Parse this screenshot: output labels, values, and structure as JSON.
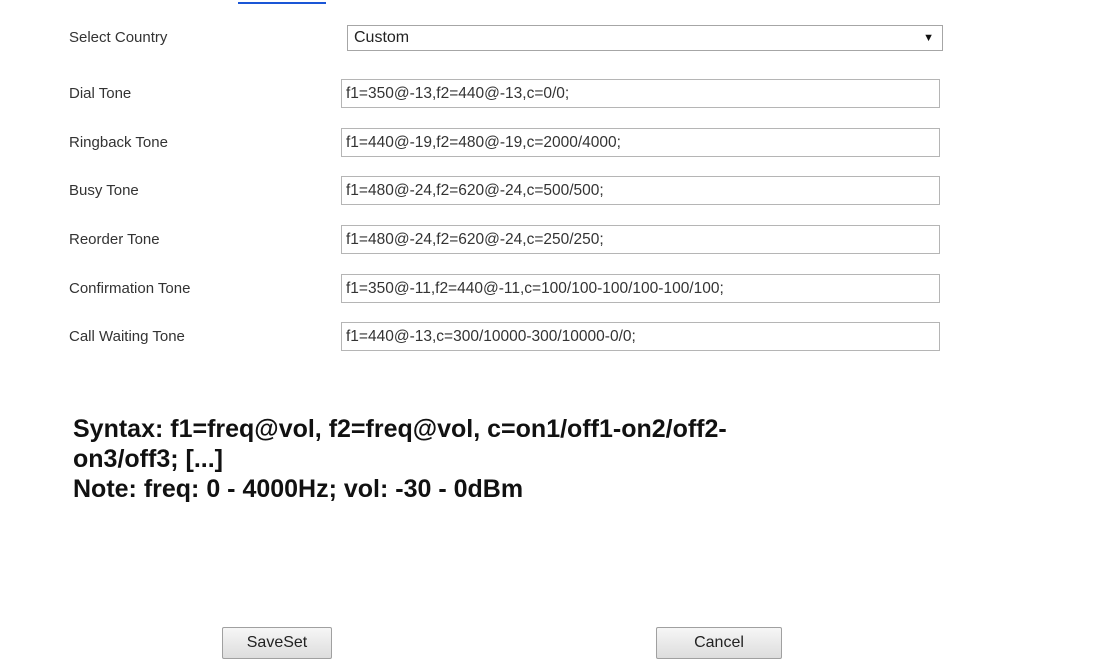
{
  "form": {
    "select_country": {
      "label": "Select Country",
      "value": "Custom"
    },
    "fields": [
      {
        "label": "Dial Tone",
        "value": "f1=350@-13,f2=440@-13,c=0/0;"
      },
      {
        "label": "Ringback Tone",
        "value": "f1=440@-19,f2=480@-19,c=2000/4000;"
      },
      {
        "label": "Busy Tone",
        "value": "f1=480@-24,f2=620@-24,c=500/500;"
      },
      {
        "label": "Reorder Tone",
        "value": "f1=480@-24,f2=620@-24,c=250/250;"
      },
      {
        "label": "Confirmation Tone",
        "value": "f1=350@-11,f2=440@-11,c=100/100-100/100-100/100;"
      },
      {
        "label": "Call Waiting Tone",
        "value": "f1=440@-13,c=300/10000-300/10000-0/0;"
      }
    ]
  },
  "help": {
    "syntax_line1": "Syntax: f1=freq@vol, f2=freq@vol, c=on1/off1-on2/off2-",
    "syntax_line2": "on3/off3; [...]",
    "note": "Note: freq: 0 - 4000Hz; vol: -30 - 0dBm"
  },
  "buttons": {
    "save_label": "SaveSet",
    "cancel_label": "Cancel"
  },
  "colors": {
    "link_underline": "#1a56d6"
  }
}
